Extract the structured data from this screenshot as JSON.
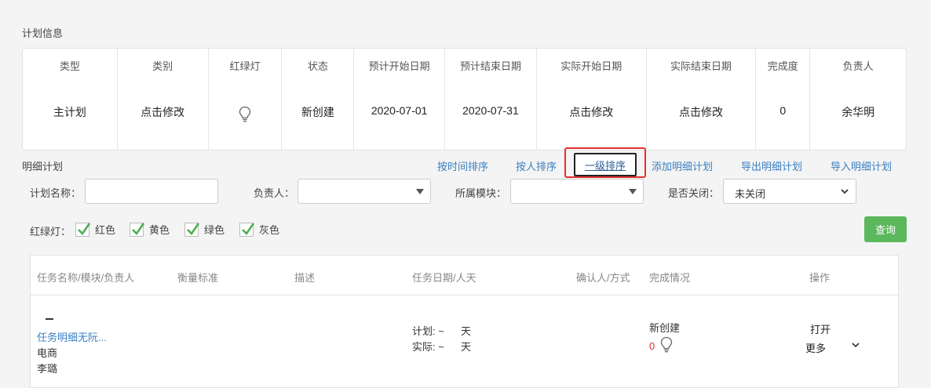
{
  "plan_info": {
    "title": "计划信息",
    "columns": [
      {
        "header": "类型",
        "value": "主计划"
      },
      {
        "header": "类别",
        "value": "点击修改"
      },
      {
        "header": "红绿灯",
        "value": ""
      },
      {
        "header": "状态",
        "value": "新创建"
      },
      {
        "header": "预计开始日期",
        "value": "2020-07-01"
      },
      {
        "header": "预计结束日期",
        "value": "2020-07-31"
      },
      {
        "header": "实际开始日期",
        "value": "点击修改"
      },
      {
        "header": "实际结束日期",
        "value": "点击修改"
      },
      {
        "header": "完成度",
        "value": "0"
      },
      {
        "header": "负责人",
        "value": "余华明"
      }
    ]
  },
  "detail": {
    "title": "明细计划",
    "actions": {
      "sort_by_time": "按时间排序",
      "sort_by_person": "按人排序",
      "level_one_sort": "一级排序",
      "add_detail": "添加明细计划",
      "export_detail": "导出明细计划",
      "import_detail": "导入明细计划"
    }
  },
  "filters": {
    "plan_name_label": "计划名称：",
    "plan_name_value": "",
    "owner_label": "负责人：",
    "owner_value": "",
    "module_label": "所属模块：",
    "module_value": "",
    "closed_label": "是否关闭：",
    "closed_value": "未关闭",
    "light_label": "红绿灯：",
    "lights": [
      {
        "label": "红色",
        "checked": true
      },
      {
        "label": "黄色",
        "checked": true
      },
      {
        "label": "绿色",
        "checked": true
      },
      {
        "label": "灰色",
        "checked": true
      }
    ],
    "query_label": "查询"
  },
  "task_table": {
    "headers": {
      "name": "任务名称/模块/负责人",
      "standard": "衡量标准",
      "desc": "描述",
      "date": "任务日期/人天",
      "confirm": "确认人/方式",
      "status": "完成情况",
      "ops": "操作"
    },
    "rows": [
      {
        "name": "任务明细无阮...",
        "module": "电商",
        "owner": "李璐",
        "plan_line": "计划: ~",
        "plan_unit": "天",
        "actual_line": "实际: ~",
        "actual_unit": "天",
        "status": "新创建",
        "progress": "0",
        "open": "打开",
        "more": "更多"
      }
    ]
  },
  "colors": {
    "link": "#3a7fc1",
    "highlight": "#e03030",
    "check": "#4caf50",
    "query_button": "#5cb85c",
    "progress_red": "#e03030"
  }
}
